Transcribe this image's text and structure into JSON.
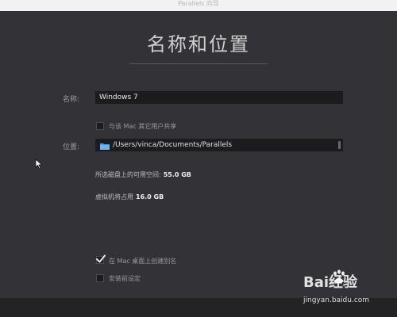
{
  "window": {
    "title": "Parallels 向导"
  },
  "page": {
    "heading": "名称和位置"
  },
  "form": {
    "name_label": "名称:",
    "name_value": "Windows 7",
    "share_label": "与该 Mac 其它用户共享",
    "share_checked": false,
    "location_label": "位置:",
    "location_value": "/Users/vinca/Documents/Parallels",
    "free_space_label": "所选磁盘上的可用空间:",
    "free_space_value": "55.0 GB",
    "vm_usage_label": "虚拟机将占用",
    "vm_usage_value": "16.0 GB",
    "alias_label": "在 Mac 桌面上创建别名",
    "alias_checked": true,
    "customize_label": "安装前设定",
    "customize_checked": false
  },
  "watermark": {
    "brand": "Bai经验",
    "url": "jingyan.baidu.com"
  },
  "colors": {
    "dialog_bg": "#333236",
    "field_bg": "#1c1c1f",
    "folder_blue": "#4a9fe6"
  },
  "icons": {
    "folder": "folder-icon",
    "checkmark": "checkmark-icon",
    "cursor": "mouse-pointer-icon",
    "paw": "baidu-paw-icon"
  }
}
